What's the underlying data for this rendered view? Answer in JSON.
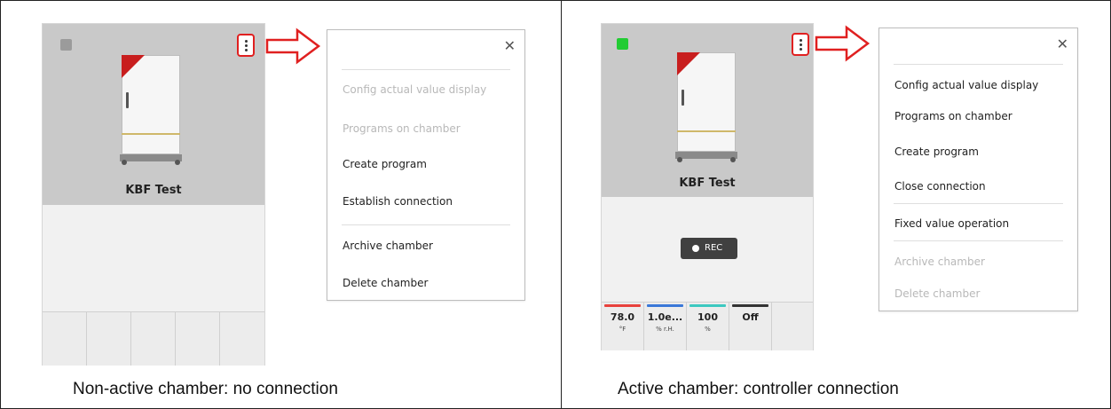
{
  "left_panel": {
    "caption": "Non-active chamber: no connection",
    "chamber": {
      "name": "KBF Test",
      "status_color": "#9b9b9b"
    },
    "menu": {
      "close_icon": "close-icon",
      "items": [
        {
          "label": "Config actual value display",
          "enabled": false
        },
        {
          "label": "Programs on chamber",
          "enabled": false
        },
        {
          "label": "Create program",
          "enabled": true
        },
        {
          "label": "Establish connection",
          "enabled": true
        },
        {
          "label": "Archive chamber",
          "enabled": true
        },
        {
          "label": "Delete chamber",
          "enabled": true
        }
      ]
    }
  },
  "right_panel": {
    "caption": "Active chamber: controller connection",
    "chamber": {
      "name": "KBF Test",
      "status_color": "#22cc33",
      "rec_label": "REC",
      "readouts": [
        {
          "value": "78.0",
          "unit": "°F",
          "color": "#e8413c"
        },
        {
          "value": "1.0e...",
          "unit": "% r.H.",
          "color": "#3a78d8"
        },
        {
          "value": "100",
          "unit": "%",
          "color": "#3cc8c0"
        },
        {
          "value": "Off",
          "unit": "",
          "color": "#333333"
        }
      ]
    },
    "menu": {
      "close_icon": "close-icon",
      "items": [
        {
          "label": "Config actual value display",
          "enabled": true
        },
        {
          "label": "Programs on chamber",
          "enabled": true
        },
        {
          "label": "Create program",
          "enabled": true
        },
        {
          "label": "Close connection",
          "enabled": true
        },
        {
          "label": "Fixed value operation",
          "enabled": true
        },
        {
          "label": "Archive chamber",
          "enabled": false
        },
        {
          "label": "Delete chamber",
          "enabled": false
        }
      ]
    }
  },
  "colors": {
    "highlight_red": "#e02020",
    "card_top_gray": "#c9c9c9",
    "card_bottom_gray": "#f1f1f1"
  }
}
